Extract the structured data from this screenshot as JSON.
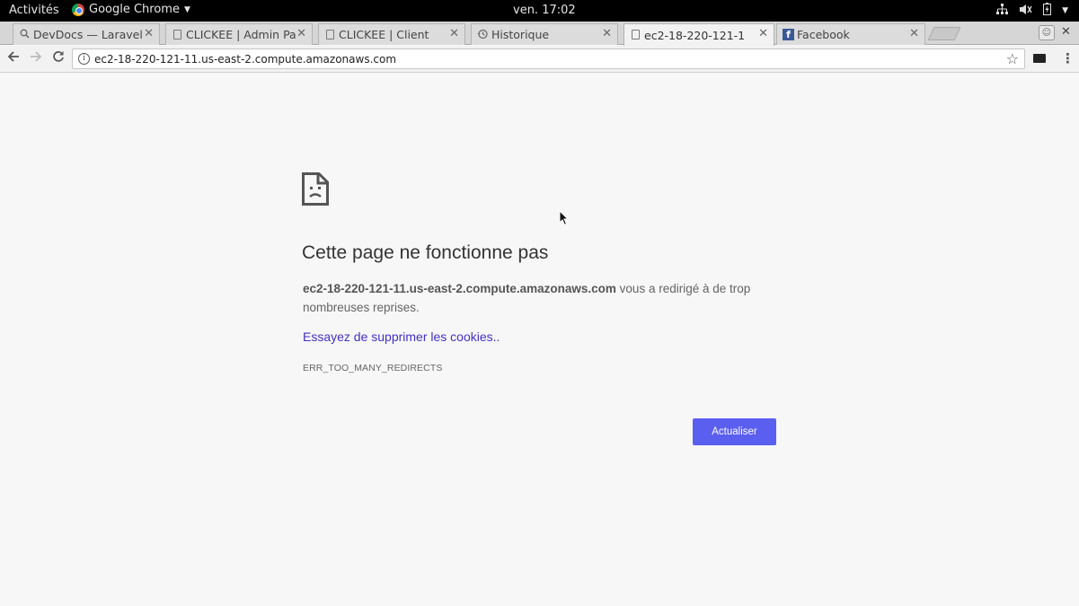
{
  "topbar": {
    "activities": "Activités",
    "app_name": "Google Chrome",
    "clock": "ven. 17:02",
    "icons": [
      "network-icon",
      "volume-icon",
      "battery-icon",
      "power-menu-icon"
    ]
  },
  "tabs": [
    {
      "title": "DevDocs — Laravel",
      "favicon": "search-icon",
      "active": false
    },
    {
      "title": "CLICKEE | Admin Pa",
      "favicon": "page-icon",
      "active": false
    },
    {
      "title": "CLICKEE | Client",
      "favicon": "page-icon",
      "active": false
    },
    {
      "title": "Historique",
      "favicon": "history-icon",
      "active": false
    },
    {
      "title": "ec2-18-220-121-1",
      "favicon": "page-icon",
      "active": true
    },
    {
      "title": "Facebook",
      "favicon": "facebook-icon",
      "active": false
    }
  ],
  "toolbar": {
    "url": "ec2-18-220-121-11.us-east-2.compute.amazonaws.com"
  },
  "error": {
    "heading": "Cette page ne fonctionne pas",
    "host": "ec2-18-220-121-11.us-east-2.compute.amazonaws.com",
    "message": " vous a redirigé à de trop nombreuses reprises.",
    "suggestion": "Essayez de supprimer les cookies..",
    "code": "ERR_TOO_MANY_REDIRECTS",
    "reload_label": "Actualiser"
  },
  "colors": {
    "accent_button": "#5b5ff0",
    "link": "#4330c4",
    "page_background": "#f7f7f7"
  }
}
